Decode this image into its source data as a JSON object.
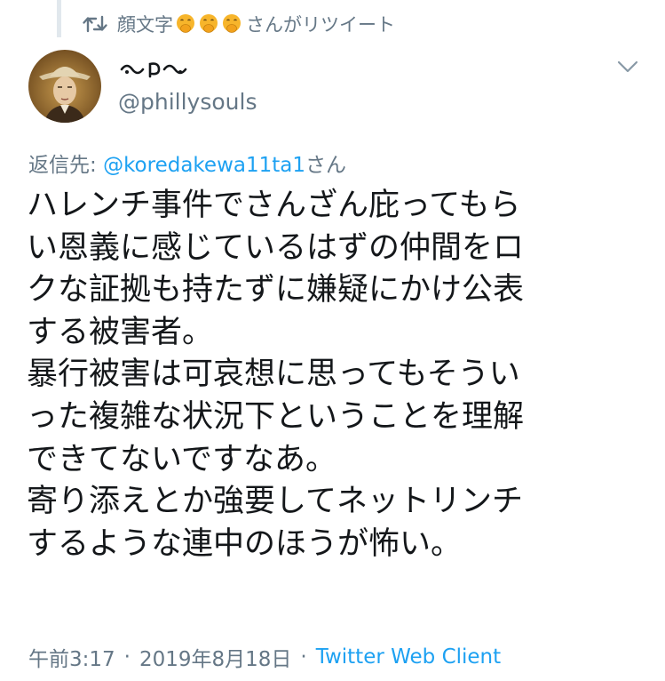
{
  "retweet": {
    "prefix": "顔文字",
    "emojis": [
      "face-with-hand-over-mouth-icon",
      "face-with-hand-over-mouth-icon",
      "face-with-hand-over-mouth-icon"
    ],
    "suffix": "さんがリツイート"
  },
  "user": {
    "display_name_icon": "decorative-swirl-name-glyphs",
    "handle": "@phillysouls"
  },
  "reply": {
    "label": "返信先: ",
    "mention": "@koredakewa11ta1",
    "honorific": "さん"
  },
  "tweet": {
    "lines": [
      "ハレンチ事件でさんざん庇ってもら",
      "い恩義に感じているはずの仲間をロ",
      "クな証拠も持たずに嫌疑にかけ公表",
      "する被害者。",
      "暴行被害は可哀想に思ってもそうい",
      "った複雑な状況下ということを理解",
      "できてないですなあ。",
      "寄り添えとか強要してネットリンチ",
      "するような連中のほうが怖い。"
    ]
  },
  "meta": {
    "time": "午前3:17",
    "separator": "·",
    "date": "2019年8月18日",
    "client": "Twitter Web Client"
  },
  "colors": {
    "text": "#14171a",
    "muted": "#657786",
    "link": "#1da1f2",
    "thread_line": "#e1e8ed",
    "emoji": "#f7b52b"
  }
}
